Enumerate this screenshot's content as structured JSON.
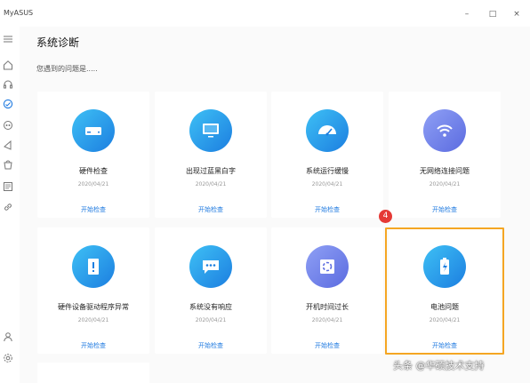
{
  "window": {
    "app_title": "MyASUS",
    "minimize_glyph": "–",
    "maximize_glyph": "□",
    "close_glyph": "×"
  },
  "sidebar": {
    "items": [
      {
        "icon": "menu-icon"
      },
      {
        "icon": "home-icon"
      },
      {
        "icon": "headset-icon"
      },
      {
        "icon": "diagnosis-icon",
        "active": true
      },
      {
        "icon": "connect-icon"
      },
      {
        "icon": "promotion-icon"
      },
      {
        "icon": "store-icon"
      },
      {
        "icon": "news-icon"
      },
      {
        "icon": "link-icon"
      },
      {
        "icon": "user-icon"
      },
      {
        "icon": "settings-icon"
      }
    ]
  },
  "header": {
    "title": "系统诊断",
    "subtitle": "您遇到的问题是....."
  },
  "cards": [
    {
      "name": "硬件检查",
      "date": "2020/04/21",
      "action": "开始检查",
      "icon": "hard-drive-icon"
    },
    {
      "name": "出现过蓝黑白字",
      "date": "2020/04/21",
      "action": "开始检查",
      "icon": "monitor-icon"
    },
    {
      "name": "系统运行缓慢",
      "date": "2020/04/21",
      "action": "开始检查",
      "icon": "speedometer-icon"
    },
    {
      "name": "无网络连接问题",
      "date": "2020/04/21",
      "action": "开始检查",
      "icon": "wifi-icon"
    },
    {
      "name": "硬件设备驱动程序异常",
      "date": "2020/04/21",
      "action": "开始检查",
      "icon": "driver-warning-icon"
    },
    {
      "name": "系统没有响应",
      "date": "2020/04/21",
      "action": "开始检查",
      "icon": "chat-dots-icon"
    },
    {
      "name": "开机时间过长",
      "date": "2020/04/21",
      "action": "开始检查",
      "icon": "loading-icon"
    },
    {
      "name": "电池问题",
      "date": "2020/04/21",
      "action": "开始检查",
      "icon": "battery-icon"
    }
  ],
  "annotation": {
    "step_number": "4"
  },
  "watermark": "头条 @华硕技术支持",
  "colors": {
    "accent": "#1f7ae0",
    "highlight": "#f5a623",
    "badge": "#e53935"
  }
}
